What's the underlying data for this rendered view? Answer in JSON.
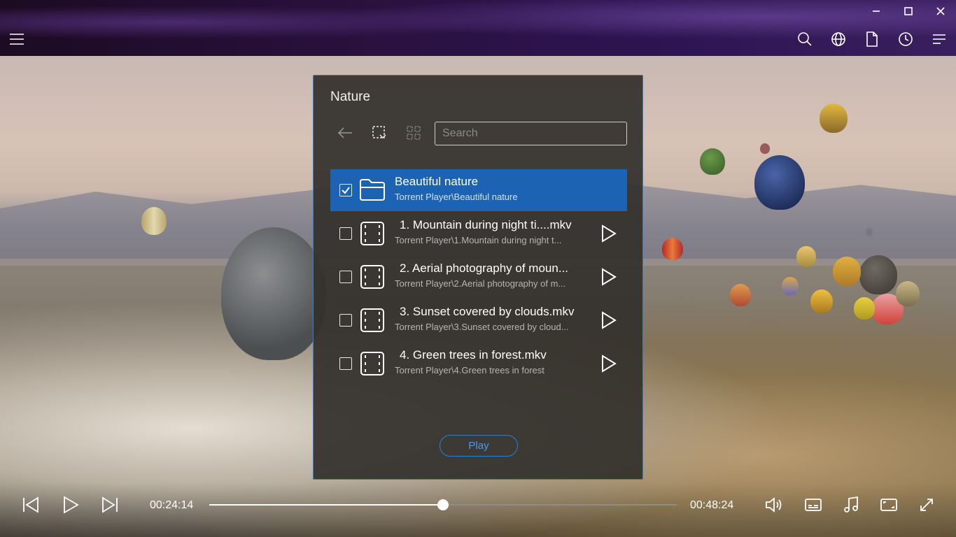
{
  "topbar": {
    "icons": {
      "menu": "hamburger-icon",
      "search": "search-icon",
      "browser": "globe-icon",
      "file": "file-icon",
      "history": "clock-icon",
      "playlist": "playlist-icon",
      "minimize": "minimize-icon",
      "maximize": "maximize-icon",
      "close": "close-icon"
    }
  },
  "dialog": {
    "title": "Nature",
    "search_placeholder": "Search",
    "items": [
      {
        "title": "Beautiful nature",
        "path": "Torrent Player\\Beautiful nature",
        "type": "folder",
        "checked": true
      },
      {
        "title": "1. Mountain during night ti....mkv",
        "path": "Torrent Player\\1.Mountain during night t...",
        "type": "video",
        "checked": false
      },
      {
        "title": "2. Aerial photography of moun...",
        "path": "Torrent Player\\2.Aerial photography of m...",
        "type": "video",
        "checked": false
      },
      {
        "title": "3. Sunset covered by clouds.mkv",
        "path": "Torrent Player\\3.Sunset covered by cloud...",
        "type": "video",
        "checked": false
      },
      {
        "title": "4. Green trees in forest.mkv",
        "path": "Torrent Player\\4.Green trees in forest",
        "type": "video",
        "checked": false
      }
    ],
    "play_label": "Play"
  },
  "player": {
    "current_time": "00:24:14",
    "total_time": "00:48:24",
    "progress": 0.5
  },
  "colors": {
    "accent": "#1d63b4",
    "border": "#2f7fd0"
  }
}
